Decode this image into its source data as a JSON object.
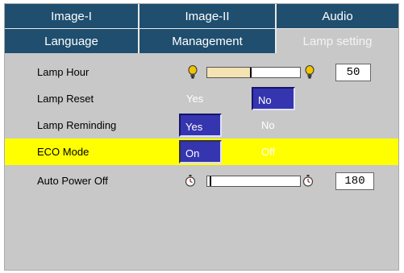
{
  "tabs_row1": [
    {
      "label": "Image-I"
    },
    {
      "label": "Image-II"
    },
    {
      "label": "Audio"
    }
  ],
  "tabs_row2": [
    {
      "label": "Language"
    },
    {
      "label": "Management"
    },
    {
      "label": "Lamp setting",
      "active": true
    }
  ],
  "rows": {
    "lamp_hour": {
      "label": "Lamp Hour",
      "value": "50",
      "level_fraction": 0.46,
      "icon": "lamp-bulb-icon"
    },
    "lamp_reset": {
      "label": "Lamp Reset",
      "options": [
        "Yes",
        "No"
      ],
      "selected": "No"
    },
    "lamp_reminding": {
      "label": "Lamp Reminding",
      "options": [
        "Yes",
        "No"
      ],
      "selected": "Yes"
    },
    "eco_mode": {
      "label": "ECO Mode",
      "options": [
        "On",
        "Off"
      ],
      "selected": "On",
      "highlighted": true
    },
    "auto_power_off": {
      "label": "Auto Power Off",
      "value": "180",
      "level_fraction": 0.03,
      "icon": "stopwatch-icon"
    }
  },
  "colors": {
    "tab_bg": "#1f4e6e",
    "panel_bg": "#c8c8c8",
    "highlight": "#ffff00",
    "selected_option": "#3535b0",
    "slider_fill": "#f5e3b3"
  }
}
